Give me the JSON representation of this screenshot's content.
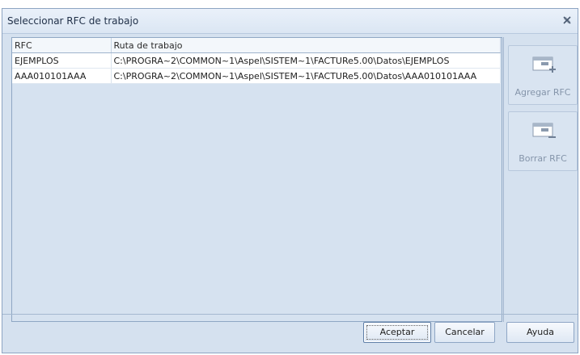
{
  "dialog": {
    "title": "Seleccionar RFC de trabajo"
  },
  "grid": {
    "columns": [
      "RFC",
      "Ruta de trabajo"
    ],
    "rows": [
      {
        "rfc": "EJEMPLOS",
        "ruta": "C:\\PROGRA~2\\COMMON~1\\Aspel\\SISTEM~1\\FACTURe5.00\\Datos\\EJEMPLOS"
      },
      {
        "rfc": "AAA010101AAA",
        "ruta": "C:\\PROGRA~2\\COMMON~1\\Aspel\\SISTEM~1\\FACTURe5.00\\Datos\\AAA010101AAA"
      }
    ]
  },
  "side_buttons": {
    "add_label": "Agregar RFC",
    "add_icon": "add-record-icon",
    "delete_label": "Borrar RFC",
    "delete_icon": "remove-record-icon",
    "disabled_color": "#8595aa"
  },
  "footer": {
    "accept_label": "Aceptar",
    "cancel_label": "Cancelar",
    "help_label": "Ayuda"
  }
}
